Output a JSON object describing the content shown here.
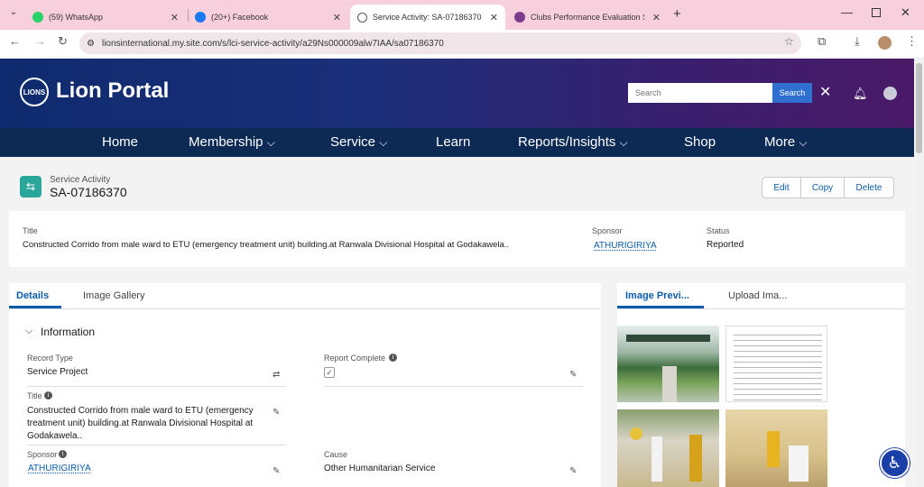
{
  "browser": {
    "tabs": [
      {
        "title": "(59) WhatsApp",
        "icon": "whatsapp-icon",
        "color": "#25d366"
      },
      {
        "title": "(20+) Facebook",
        "icon": "facebook-icon",
        "color": "#1877f2"
      },
      {
        "title": "Service Activity: SA-07186370",
        "icon": "globe-icon",
        "color": "#555555"
      },
      {
        "title": "Clubs Performance Evaluation S",
        "icon": "lions-icon",
        "color": "#7a3d8e"
      }
    ],
    "url": "lionsinternational.my.site.com/s/lci-service-activity/a29Ns000009alw7IAA/sa07186370"
  },
  "portal": {
    "logo_text": "Lion Portal",
    "search_placeholder": "Search",
    "search_button": "Search",
    "nav": [
      "Home",
      "Membership",
      "Service",
      "Learn",
      "Reports/Insights",
      "Shop",
      "More"
    ],
    "chevron": "⌄"
  },
  "record": {
    "object": "Service Activity",
    "name": "SA-07186370",
    "actions": [
      "Edit",
      "Copy",
      "Delete"
    ],
    "highlights": {
      "title_label": "Title",
      "title_value": "Constructed Corrido from male ward to ETU (emergency treatment unit) building.at Ranwala Divisional Hospital at Godakawela..",
      "sponsor_label": "Sponsor",
      "sponsor_value": "ATHURIGIRIYA",
      "status_label": "Status",
      "status_value": "Reported"
    }
  },
  "details": {
    "tabs": [
      "Details",
      "Image Gallery"
    ],
    "section": "Information",
    "record_type_label": "Record Type",
    "record_type_value": "Service Project",
    "report_complete_label": "Report Complete",
    "title_label": "Title",
    "title_value": "Constructed Corrido from male ward to ETU (emergency treatment unit) building.at Ranwala Divisional Hospital at Godakawela..",
    "sponsor_label": "Sponsor",
    "sponsor_value": "ATHURIGIRIYA",
    "cause_label": "Cause",
    "cause_value": "Other Humanitarian Service"
  },
  "images": {
    "tabs": [
      "Image Previ...",
      "Upload Ima..."
    ]
  }
}
